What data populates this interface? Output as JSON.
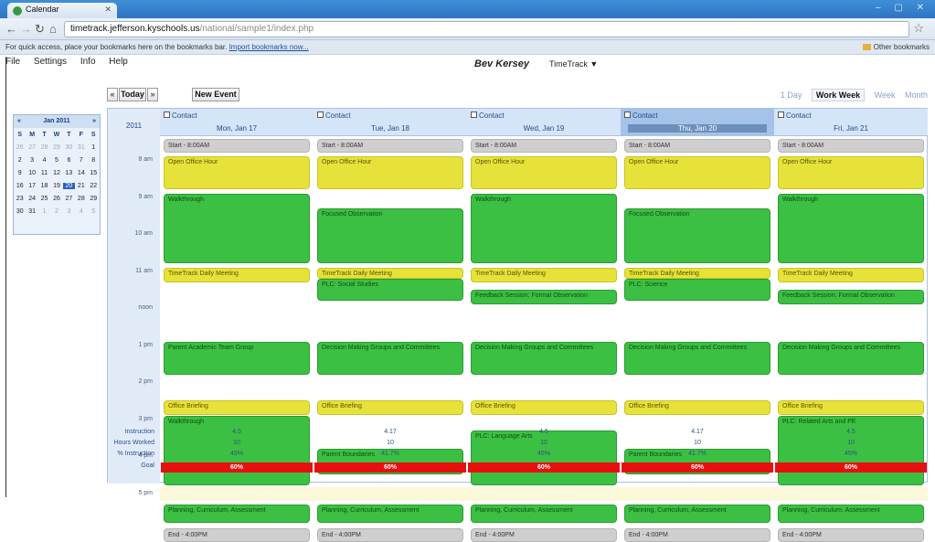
{
  "browser": {
    "tab_title": "Calendar",
    "url_host": "timetrack.jefferson.kyschools.us",
    "url_path": "/national/sample1/index.php",
    "bookmarks_message": "For quick access, place your bookmarks here on the bookmarks bar.",
    "bookmarks_link": "Import bookmarks now...",
    "other_bookmarks": "Other bookmarks"
  },
  "menu": {
    "items": [
      "File",
      "Settings",
      "Info",
      "Help"
    ]
  },
  "header": {
    "user_name": "Bev Kersey",
    "app_name": "TimeTrack ▼"
  },
  "controls": {
    "prev": "«",
    "today": "Today",
    "next": "»",
    "new_event": "New Event",
    "views": [
      "1 Day",
      "Work Week",
      "Week",
      "Month"
    ],
    "active_view": "Work Week"
  },
  "mini_calendar": {
    "title": "Jan 2011",
    "prev": "«",
    "next": "»",
    "weekdays": [
      "S",
      "M",
      "T",
      "W",
      "T",
      "F",
      "S"
    ],
    "weeks": [
      [
        "26",
        "27",
        "28",
        "29",
        "30",
        "31",
        "1"
      ],
      [
        "2",
        "3",
        "4",
        "5",
        "6",
        "7",
        "8"
      ],
      [
        "9",
        "10",
        "11",
        "12",
        "13",
        "14",
        "15"
      ],
      [
        "16",
        "17",
        "18",
        "19",
        "20",
        "21",
        "22"
      ],
      [
        "23",
        "24",
        "25",
        "26",
        "27",
        "28",
        "29"
      ],
      [
        "30",
        "31",
        "1",
        "2",
        "3",
        "4",
        "5"
      ]
    ],
    "selected": "20"
  },
  "grid": {
    "year": "2011",
    "hours": [
      "8 am",
      "9 am",
      "10 am",
      "11 am",
      "noon",
      "1 pm",
      "2 pm",
      "3 pm",
      "4 pm",
      "5 pm"
    ],
    "days": [
      {
        "contact": "Contact",
        "date": "Mon, Jan 17",
        "today": false
      },
      {
        "contact": "Contact",
        "date": "Tue, Jan 18",
        "today": false
      },
      {
        "contact": "Contact",
        "date": "Wed, Jan 19",
        "today": false
      },
      {
        "contact": "Contact",
        "date": "Thu, Jan 20",
        "today": true
      },
      {
        "contact": "Contact",
        "date": "Fri, Jan 21",
        "today": false
      }
    ],
    "start_label": "Start - 8:00AM",
    "end_label": "End - 4:00PM",
    "events": [
      [
        {
          "title": "Open Office Hour",
          "color": "y",
          "start": 8.0,
          "end": 8.9
        },
        {
          "title": "Walkthrough",
          "color": "g",
          "start": 9.0,
          "end": 10.9
        },
        {
          "title": "TimeTrack Daily Meeting",
          "color": "y",
          "start": 11.0,
          "end": 11.4
        },
        {
          "title": "Parent Academic Team Group",
          "color": "g",
          "start": 13.0,
          "end": 13.9
        },
        {
          "title": "Office Briefing",
          "color": "y",
          "start": 14.6,
          "end": 15.0
        },
        {
          "title": "Walkthrough",
          "color": "g",
          "start": 15.0,
          "end": 16.9
        },
        {
          "title": "Planning, Curriculum, Assessment",
          "color": "g",
          "start": 17.4,
          "end": 17.9
        }
      ],
      [
        {
          "title": "Open Office Hour",
          "color": "y",
          "start": 8.0,
          "end": 8.9
        },
        {
          "title": "Focused Observation",
          "color": "g",
          "start": 9.4,
          "end": 10.9
        },
        {
          "title": "TimeTrack Daily Meeting",
          "color": "y",
          "start": 11.0,
          "end": 11.3
        },
        {
          "title": "PLC: Social Studies",
          "color": "g",
          "start": 11.3,
          "end": 11.9
        },
        {
          "title": "Decision Making Groups and Committees",
          "color": "g",
          "start": 13.0,
          "end": 13.9
        },
        {
          "title": "Office Briefing",
          "color": "y",
          "start": 14.6,
          "end": 15.0
        },
        {
          "title": "Parent Boundaries",
          "color": "g",
          "start": 15.9,
          "end": 16.6
        },
        {
          "title": "Planning, Curriculum, Assessment",
          "color": "g",
          "start": 17.4,
          "end": 17.9
        }
      ],
      [
        {
          "title": "Open Office Hour",
          "color": "y",
          "start": 8.0,
          "end": 8.9
        },
        {
          "title": "Walkthrough",
          "color": "g",
          "start": 9.0,
          "end": 10.9
        },
        {
          "title": "TimeTrack Daily Meeting",
          "color": "y",
          "start": 11.0,
          "end": 11.4
        },
        {
          "title": "Feedback Session: Formal Observation",
          "color": "g",
          "start": 11.6,
          "end": 12.0
        },
        {
          "title": "Decision Making Groups and Committees",
          "color": "g",
          "start": 13.0,
          "end": 13.9
        },
        {
          "title": "Office Briefing",
          "color": "y",
          "start": 14.6,
          "end": 15.0
        },
        {
          "title": "PLC: Language Arts",
          "color": "g",
          "start": 15.4,
          "end": 16.9
        },
        {
          "title": "Planning, Curriculum, Assessment",
          "color": "g",
          "start": 17.4,
          "end": 17.9
        }
      ],
      [
        {
          "title": "Open Office Hour",
          "color": "y",
          "start": 8.0,
          "end": 8.9
        },
        {
          "title": "Focused Observation",
          "color": "g",
          "start": 9.4,
          "end": 10.9
        },
        {
          "title": "TimeTrack Daily Meeting",
          "color": "y",
          "start": 11.0,
          "end": 11.3
        },
        {
          "title": "PLC: Science",
          "color": "g",
          "start": 11.3,
          "end": 11.9
        },
        {
          "title": "Decision Making Groups and Committees",
          "color": "g",
          "start": 13.0,
          "end": 13.9
        },
        {
          "title": "Office Briefing",
          "color": "y",
          "start": 14.6,
          "end": 15.0
        },
        {
          "title": "Parent Boundaries",
          "color": "g",
          "start": 15.9,
          "end": 16.6
        },
        {
          "title": "Planning, Curriculum, Assessment",
          "color": "g",
          "start": 17.4,
          "end": 17.9
        }
      ],
      [
        {
          "title": "Open Office Hour",
          "color": "y",
          "start": 8.0,
          "end": 8.9
        },
        {
          "title": "Walkthrough",
          "color": "g",
          "start": 9.0,
          "end": 10.9
        },
        {
          "title": "TimeTrack Daily Meeting",
          "color": "y",
          "start": 11.0,
          "end": 11.4
        },
        {
          "title": "Feedback Session: Formal Observation",
          "color": "g",
          "start": 11.6,
          "end": 12.0
        },
        {
          "title": "Decision Making Groups and Committees",
          "color": "g",
          "start": 13.0,
          "end": 13.9
        },
        {
          "title": "Office Briefing",
          "color": "y",
          "start": 14.6,
          "end": 15.0
        },
        {
          "title": "PLC: Related Arts and PE",
          "color": "g",
          "start": 15.0,
          "end": 16.9
        },
        {
          "title": "Planning, Curriculum, Assessment",
          "color": "g",
          "start": 17.4,
          "end": 17.9
        }
      ]
    ]
  },
  "footer": {
    "labels": [
      "Instruction",
      "Hours Worked",
      "% Instruction",
      "Goal"
    ],
    "instruction": [
      "4.5",
      "4.17",
      "4.5",
      "4.17",
      "4.5"
    ],
    "hours": [
      "10",
      "10",
      "10",
      "10",
      "10"
    ],
    "pct": [
      "45%",
      "41.7%",
      "45%",
      "41.7%",
      "45%"
    ],
    "goal": [
      "60%",
      "60%",
      "60%",
      "60%",
      "60%"
    ]
  }
}
